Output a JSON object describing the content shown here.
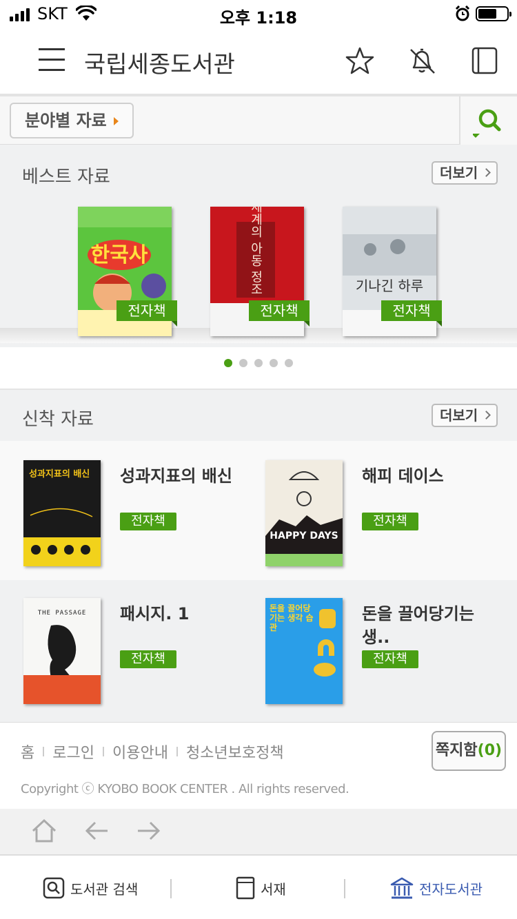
{
  "status_bar": {
    "carrier": "SKT",
    "time": "오후 1:18"
  },
  "header": {
    "title": "국립세종도서관"
  },
  "category": {
    "button_label": "분야별 자료"
  },
  "best": {
    "title": "베스트 자료",
    "more_label": "더보기",
    "books": [
      {
        "badge": "전자책",
        "cover_title": "한국사"
      },
      {
        "badge": "전자책",
        "cover_title": "세계의 아동 정조"
      },
      {
        "badge": "전자책",
        "cover_title": "기나긴 하루"
      }
    ],
    "page_count": 5,
    "active_page": 1
  },
  "new": {
    "title": "신착 자료",
    "more_label": "더보기",
    "books": [
      {
        "title": "성과지표의 배신",
        "badge": "전자책",
        "cover_title": "성과지표의 배신"
      },
      {
        "title": "해피 데이스",
        "badge": "전자책",
        "cover_title": "HAPPY DAYS"
      },
      {
        "title": "패시지. 1",
        "badge": "전자책",
        "cover_title": "THE PASSAGE"
      },
      {
        "title": "돈을 끌어당기는 생..",
        "badge": "전자책",
        "cover_title": "돈을 끌어당기는 생각 습관"
      }
    ]
  },
  "footer": {
    "links": [
      "홈",
      "로그인",
      "이용안내",
      "청소년보호정책"
    ],
    "copyright": "Copyright ⓒ KYOBO BOOK CENTER . All rights reserved.",
    "message_label": "쪽지함",
    "message_count": "(0)"
  },
  "tabbar": {
    "search_label": "도서관 검색",
    "shelf_label": "서재",
    "ebook_label": "전자도서관"
  },
  "colors": {
    "accent": "#4a9f14",
    "tab_active": "#3a5bb0"
  }
}
